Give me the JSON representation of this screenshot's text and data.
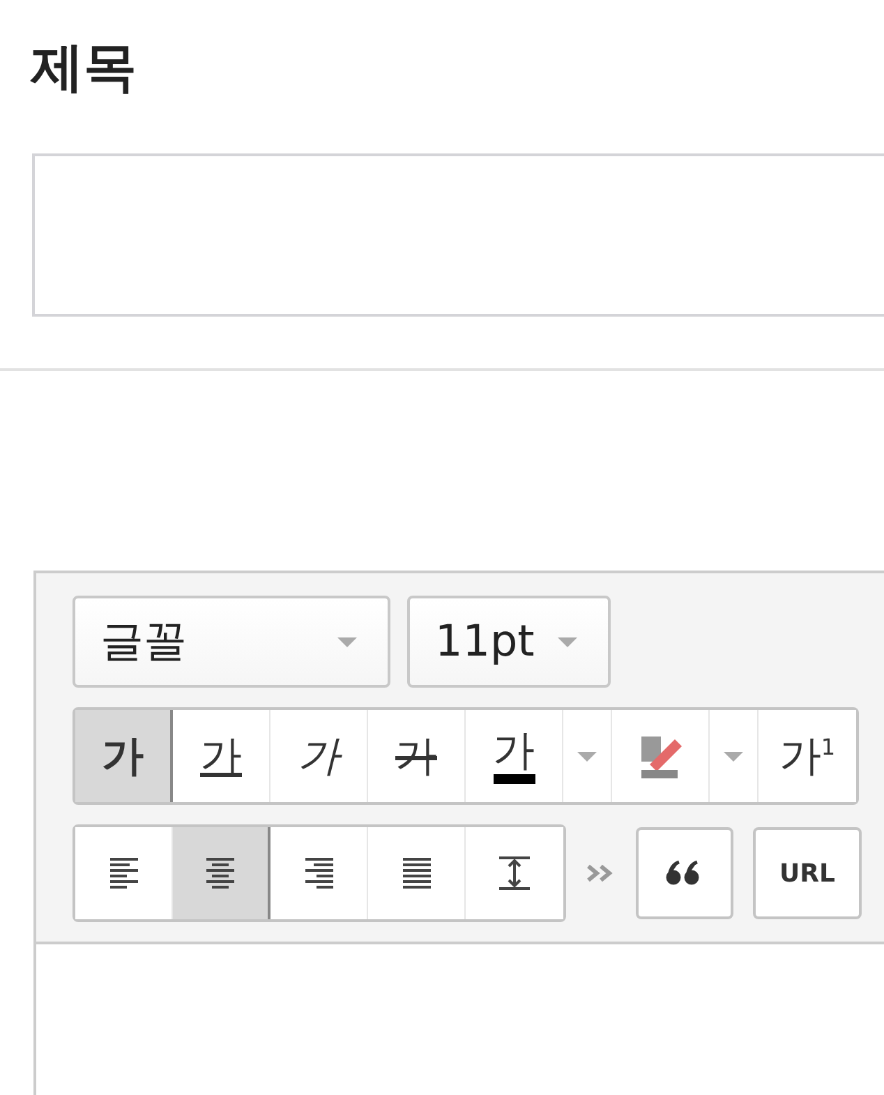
{
  "heading": "제목",
  "toolbar": {
    "font_select": "글꼴",
    "size_select": "11pt",
    "format_buttons": [
      {
        "kind": "bold",
        "label": "가",
        "selected": true
      },
      {
        "kind": "underline",
        "label": "가",
        "selected": false
      },
      {
        "kind": "italic",
        "label": "가",
        "selected": false
      },
      {
        "kind": "strike",
        "label": "가",
        "selected": false
      },
      {
        "kind": "color",
        "label": "가",
        "selected": false
      },
      {
        "kind": "dropdown",
        "selected": false
      },
      {
        "kind": "highlight",
        "selected": false
      },
      {
        "kind": "dropdown",
        "selected": false
      },
      {
        "kind": "superscript",
        "label": "가$^{1}$",
        "selected": false
      }
    ],
    "align_buttons": [
      {
        "kind": "left",
        "selected": false
      },
      {
        "kind": "center",
        "selected": true
      },
      {
        "kind": "right",
        "selected": false
      },
      {
        "kind": "justify",
        "selected": false
      },
      {
        "kind": "line-height",
        "selected": false
      }
    ],
    "url_button": "URL"
  }
}
